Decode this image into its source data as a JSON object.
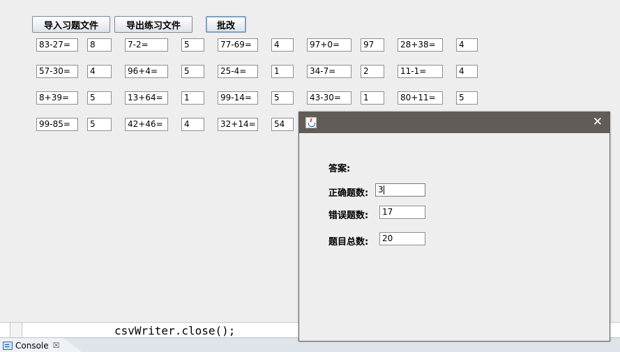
{
  "toolbar": {
    "import_label": "导入习题文件",
    "export_label": "导出练习文件",
    "grade_label": "批改"
  },
  "problems": [
    {
      "q": "83-27=",
      "a": "8"
    },
    {
      "q": "7-2=",
      "a": "5"
    },
    {
      "q": "77-69=",
      "a": "4"
    },
    {
      "q": "97+0=",
      "a": "97"
    },
    {
      "q": "28+38=",
      "a": "4"
    },
    {
      "q": "57-30=",
      "a": "4"
    },
    {
      "q": "96+4=",
      "a": "5"
    },
    {
      "q": "25-4=",
      "a": "1"
    },
    {
      "q": "34-7=",
      "a": "2"
    },
    {
      "q": "11-1=",
      "a": "4"
    },
    {
      "q": "8+39=",
      "a": "5"
    },
    {
      "q": "13+64=",
      "a": "1"
    },
    {
      "q": "99-14=",
      "a": "5"
    },
    {
      "q": "43-30=",
      "a": "1"
    },
    {
      "q": "80+11=",
      "a": "5"
    },
    {
      "q": "99-85=",
      "a": "5"
    },
    {
      "q": "42+46=",
      "a": "4"
    },
    {
      "q": "32+14=",
      "a": "54"
    }
  ],
  "editor": {
    "code_line": "csvWriter.close();"
  },
  "console": {
    "tab_label": "Console",
    "close_glyph": "☒"
  },
  "dialog": {
    "close_glyph": "✕",
    "answer_label": "答案:",
    "correct_label": "正确题数:",
    "correct_value": "3",
    "wrong_label": "错误题数:",
    "wrong_value": "17",
    "total_label": "题目总数:",
    "total_value": "20"
  },
  "icons": {
    "java": "java-cup-icon",
    "console": "console-icon",
    "close": "close-icon"
  }
}
